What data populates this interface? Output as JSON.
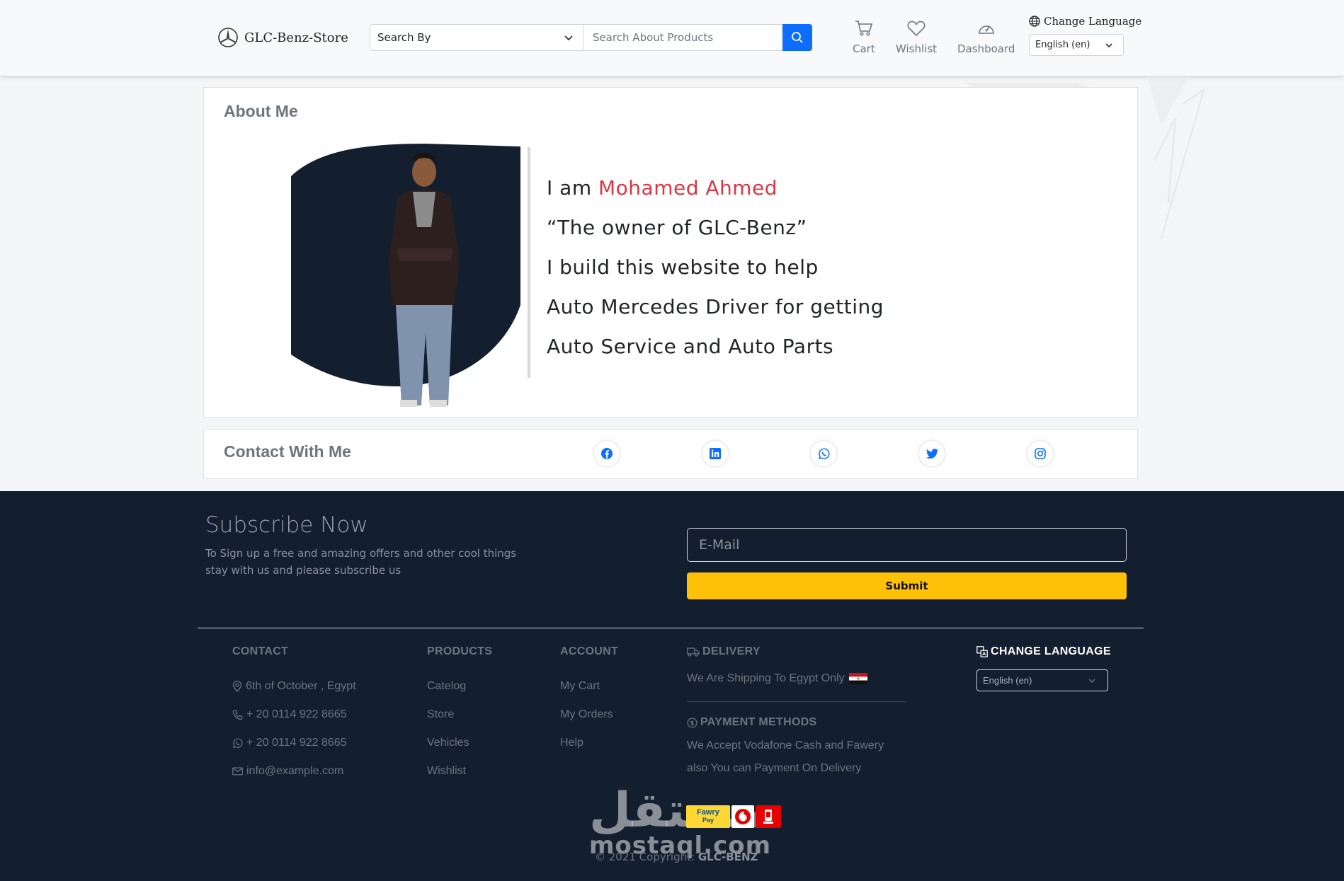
{
  "header": {
    "brand": "GLC-Benz-Store",
    "search_by": "Search By",
    "search_placeholder": "Search About Products",
    "nav": {
      "cart": "Cart",
      "wishlist": "Wishlist",
      "dashboard": "Dashboard"
    },
    "change_language": "Change Language",
    "language_selected": "English (en)"
  },
  "about": {
    "title": "About Me",
    "intro": "I am ",
    "name": "Mohamed Ahmed",
    "lines": [
      "“The owner of GLC-Benz”",
      "I build this website to help",
      "Auto Mercedes Driver for getting",
      "Auto Service and Auto Parts"
    ]
  },
  "contact_with_me": {
    "title": "Contact With Me",
    "icons": [
      "facebook-icon",
      "linkedin-icon",
      "whatsapp-icon",
      "twitter-icon",
      "instagram-icon"
    ]
  },
  "subscribe": {
    "title": "Subscribe Now",
    "text_line1": "To Sign up a free and amazing offers and other cool things",
    "text_line2": "stay with us and please subscribe us",
    "email_placeholder": "E-Mail",
    "submit": "Submit"
  },
  "footer": {
    "contact": {
      "title": "CONTACT",
      "address": "6th of October , Egypt",
      "phone": "+ 20 0114 922 8665",
      "whatsapp": "+ 20 0114 922 8665",
      "email": "info@example.com"
    },
    "products": {
      "title": "PRODUCTS",
      "items": [
        "Catelog",
        "Store",
        "Vehicles",
        "Wishlist"
      ]
    },
    "account": {
      "title": "ACCOUNT",
      "items": [
        "My Cart",
        "My Orders",
        "Help"
      ]
    },
    "delivery": {
      "title": "DELIVERY",
      "text": "We Are Shipping To Egypt Only"
    },
    "payment": {
      "title": "PAYMENT METHODS",
      "line1": "We Accept Vodafone Cash and Fawery",
      "line2": "also You can Payment On Delivery",
      "badges": {
        "fawry": "Fawry",
        "fawry_sub": "Pay"
      }
    },
    "change_language": {
      "title": "CHANGE LANGUAGE",
      "selected": "English (en)"
    },
    "copyright_prefix": "© 2021 Copyright: ",
    "copyright_brand": "GLC-BENZ",
    "watermark_ar": "مستقل",
    "watermark_en": "mostaql.com"
  },
  "colors": {
    "accent": "#0d6efd",
    "name": "#dc3545",
    "footer_bg": "#131f2f",
    "submit": "#ffc107"
  }
}
